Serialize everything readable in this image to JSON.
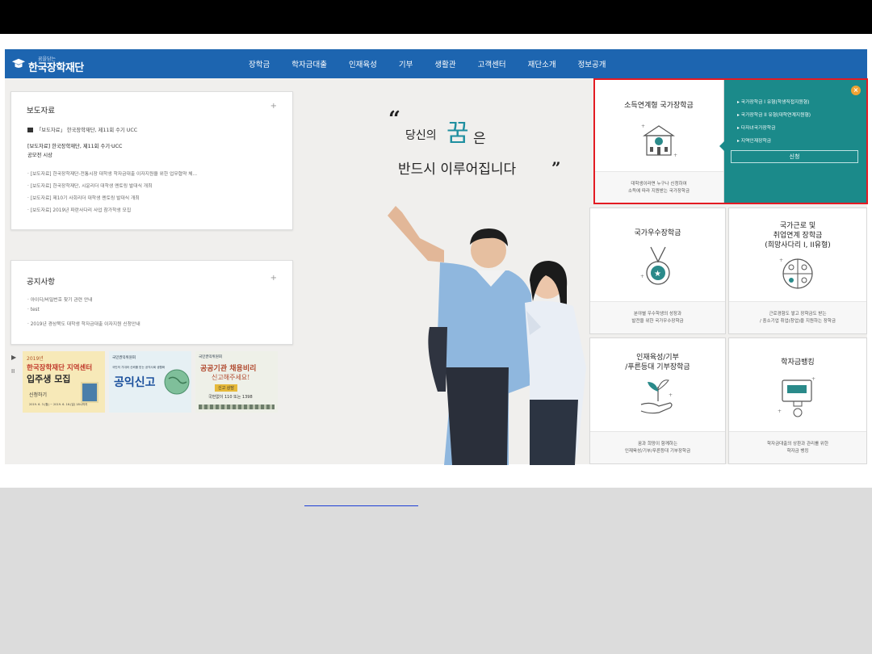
{
  "nav": {
    "logo_sub": "꿈을담는",
    "logo_text": "한국장학재단",
    "menu": [
      "장학금",
      "학자금대출",
      "인재육성",
      "기부",
      "생활관",
      "고객센터",
      "재단소개",
      "정보공개"
    ]
  },
  "press": {
    "title": "보도자료",
    "more": "+",
    "featured": "「보도자료」 한국장학재단, 제11회 수기 UCC",
    "headline_1": "[보도자료] 한국장학재단, 제11회 수기·UCC",
    "headline_2": "공모전 시상",
    "items": [
      "[보도자료] 한국장학재단-전통시장 대학생 학자금대출 이자지원을 위한 업무협약 체...",
      "[보도자료] 한국장학재단, 시윤리더 대학생 멘토링 발대식 개최",
      "[보도자료] 제10기 사회리더 대학생 멘토링 발대식 개최",
      "[보도자료] 2019년 파란사다리 사업 참가학생 모집"
    ]
  },
  "notice": {
    "title": "공지사항",
    "more": "+",
    "items": [
      "아이디/비밀번호 찾기 관련 안내",
      "test",
      "2019년 경상북도 대학생 학자금대출 이자지원 신청안내"
    ]
  },
  "banners": {
    "b1_year": "2019년",
    "b1_title_1": "한국장학재단 지역센터",
    "b1_title_2": "입주생 모집",
    "b1_apply": "신청하기",
    "b1_date": "2019. 6. 3.(월) ~ 2019. 6. 16.(일) 18시까지",
    "b2_org": "국민권익위원회",
    "b2_sub": "국민의 기대와 신뢰를 받는 공직사회 생활화",
    "b2_title": "공익신고",
    "b3_org": "국민권익위원회",
    "b3_title_1": "공공기관 채용비리",
    "b3_title_2": "신고해주세요!",
    "b3_tag": "신고 상담",
    "b3_phone": "국번없이 110 또는 1398",
    "ctrl_prev": "▶",
    "ctrl_pause": "II"
  },
  "hero": {
    "open_quote": "“",
    "line1_a": "당신의",
    "line1_dream": "꿈",
    "line1_b": "은",
    "line2": "반드시 이루어집니다",
    "close_quote": "”"
  },
  "cards": {
    "c1_title": "소득연계형 국가장학금",
    "c1_desc_1": "대학생이라면 누구나 신청하여",
    "c1_desc_2": "소득에 따라 지원받는 국가장학금",
    "c2_title": "국가우수장학금",
    "c2_desc_1": "분야별 우수학생의 성장과",
    "c2_desc_2": "발전을 위한 국가우수장학금",
    "c3_title_1": "국가근로 및",
    "c3_title_2": "취업연계 장학금",
    "c3_title_3": "(희망사다리 I, II유형)",
    "c3_desc_1": "근로경험도 쌓고 장학금도 받는",
    "c3_desc_2": "/ 중소기업 취업(창업)을 지원하는 장학금",
    "c4_title_1": "인재육성/기부",
    "c4_title_2": "/푸른등대 기부장학금",
    "c4_desc_1": "꿈과 희망이 함께하는",
    "c4_desc_2": "인재육성/기부/푸른등대 기부장학금",
    "c5_title": "학자금뱅킹",
    "c5_desc_1": "학자금대출의 상환과 관리를 위한",
    "c5_desc_2": "학자금 뱅킹"
  },
  "popup": {
    "items": [
      "국가장학금 I 유형(학생직접지원형)",
      "국가장학금 II 유형(대학연계지원형)",
      "다자녀국가장학금",
      "지역인재장학금"
    ],
    "apply": "신청",
    "close": "×",
    "accent": "#1b8a8a"
  },
  "colors": {
    "nav": "#1d65b0",
    "highlight": "#e31b23",
    "dream": "#1f8fa0"
  }
}
